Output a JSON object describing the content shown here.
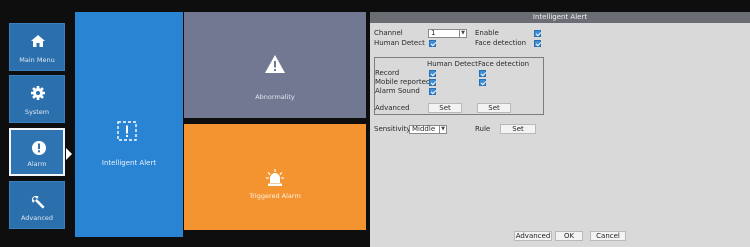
{
  "sidebar": {
    "items": [
      {
        "label": "Main Menu"
      },
      {
        "label": "System"
      },
      {
        "label": "Alarm"
      },
      {
        "label": "Advanced"
      }
    ]
  },
  "tiles": {
    "intelligent_alert": "Intelligent Alert",
    "abnormality": "Abnormality",
    "triggered_alarm": "Triggered Alarm"
  },
  "dialog": {
    "title": "Intelligent Alert",
    "channel_label": "Channel",
    "channel_value": "1",
    "enable_label": "Enable",
    "human_detect_label": "Human Detect",
    "face_detection_label": "Face detection",
    "col_human_detect": "Human Detect",
    "col_face_detection": "Face detection",
    "record_label": "Record",
    "mobile_reported_label": "Mobile reported",
    "alarm_sound_label": "Alarm Sound",
    "advanced_label": "Advanced",
    "set_label": "Set",
    "sensitivity_label": "Sensitivity",
    "sensitivity_value": "Middle",
    "rule_label": "Rule",
    "footer": {
      "advanced": "Advanced",
      "ok": "OK",
      "cancel": "Cancel"
    }
  },
  "colors": {
    "accent": "#3d8fd8",
    "intelligent_tile": "#2a84d4",
    "abnormality_tile": "#727891",
    "triggered_tile": "#f39430"
  }
}
